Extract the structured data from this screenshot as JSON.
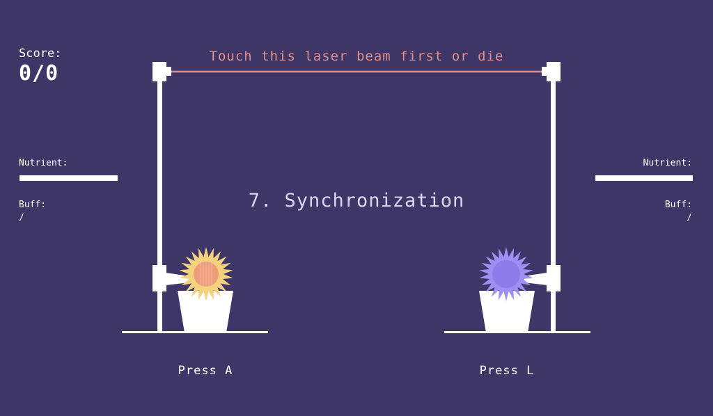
{
  "hud": {
    "score_label": "Score:",
    "score_value": "0/0",
    "left": {
      "nutrient_label": "Nutrient:",
      "nutrient_level": 1.0,
      "buff_label": "Buff:",
      "buff_value": "/"
    },
    "right": {
      "nutrient_label": "Nutrient:",
      "nutrient_level": 1.0,
      "buff_label": "Buff:",
      "buff_value": "/"
    }
  },
  "laser_label": "Touch this laser beam first or die",
  "level_title": "7. Synchronization",
  "players": {
    "left": {
      "prompt": "Press A",
      "flower_color": "#f6d27f",
      "flower_center": "#ef9d7b",
      "icon": "spiky-sun-flower-icon"
    },
    "right": {
      "prompt": "Press L",
      "flower_color": "#9f8ef3",
      "flower_center": "#8f7ceb",
      "icon": "spiky-purple-flower-icon"
    }
  },
  "colors": {
    "background": "#3f3668",
    "laser": "#e08f8a",
    "frame": "#ffffff",
    "title": "#d9d7f2"
  }
}
